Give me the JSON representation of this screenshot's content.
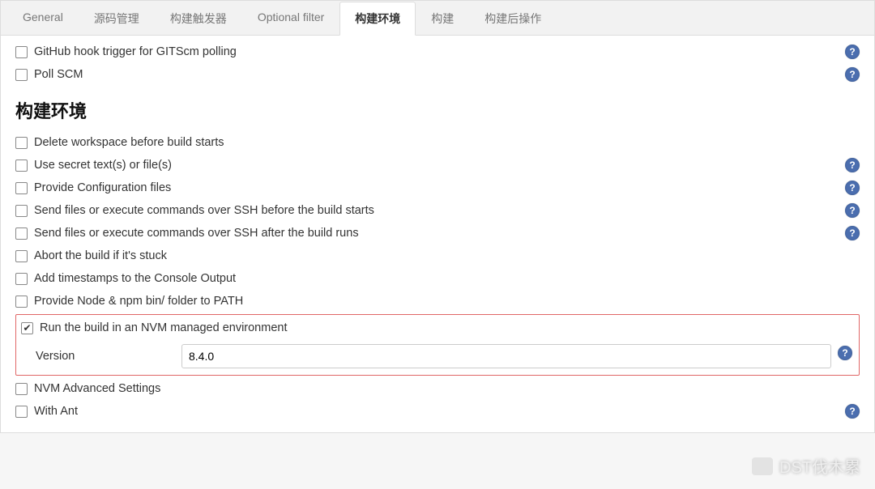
{
  "tabs": [
    {
      "label": "General"
    },
    {
      "label": "源码管理"
    },
    {
      "label": "构建触发器"
    },
    {
      "label": "Optional filter"
    },
    {
      "label": "构建环境",
      "active": true
    },
    {
      "label": "构建"
    },
    {
      "label": "构建后操作"
    }
  ],
  "top_options": [
    {
      "label": "GitHub hook trigger for GITScm polling",
      "help": true
    },
    {
      "label": "Poll SCM",
      "help": true
    }
  ],
  "section_title": "构建环境",
  "env_options": [
    {
      "label": "Delete workspace before build starts",
      "help": false,
      "checked": false
    },
    {
      "label": "Use secret text(s) or file(s)",
      "help": true,
      "checked": false
    },
    {
      "label": "Provide Configuration files",
      "help": true,
      "checked": false
    },
    {
      "label": "Send files or execute commands over SSH before the build starts",
      "help": true,
      "checked": false
    },
    {
      "label": "Send files or execute commands over SSH after the build runs",
      "help": true,
      "checked": false
    },
    {
      "label": "Abort the build if it's stuck",
      "help": false,
      "checked": false
    },
    {
      "label": "Add timestamps to the Console Output",
      "help": false,
      "checked": false
    },
    {
      "label": "Provide Node & npm bin/ folder to PATH",
      "help": false,
      "checked": false
    }
  ],
  "nvm": {
    "label": "Run the build in an NVM managed environment",
    "checked": true,
    "version_label": "Version",
    "version_value": "8.4.0",
    "help": true
  },
  "tail_options": [
    {
      "label": "NVM Advanced Settings",
      "help": false,
      "checked": false
    },
    {
      "label": "With Ant",
      "help": true,
      "checked": false
    }
  ],
  "watermark": "DST伐木累"
}
